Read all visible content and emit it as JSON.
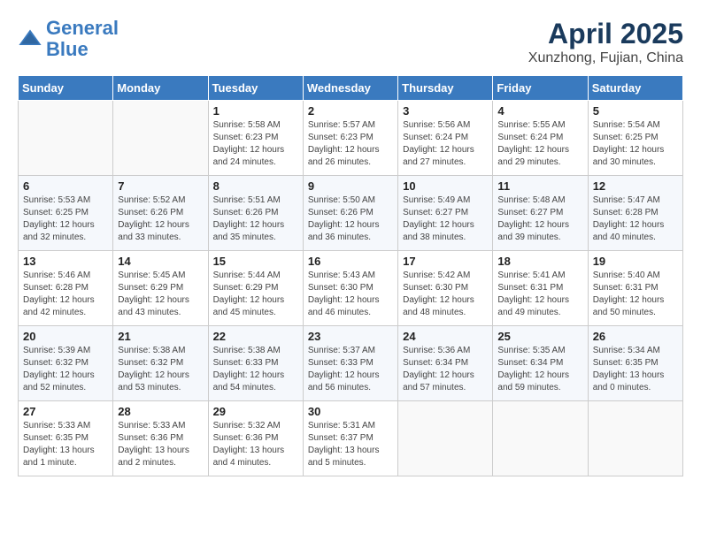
{
  "header": {
    "logo_line1": "General",
    "logo_line2": "Blue",
    "month": "April 2025",
    "location": "Xunzhong, Fujian, China"
  },
  "weekdays": [
    "Sunday",
    "Monday",
    "Tuesday",
    "Wednesday",
    "Thursday",
    "Friday",
    "Saturday"
  ],
  "weeks": [
    [
      {
        "day": "",
        "info": ""
      },
      {
        "day": "",
        "info": ""
      },
      {
        "day": "1",
        "info": "Sunrise: 5:58 AM\nSunset: 6:23 PM\nDaylight: 12 hours\nand 24 minutes."
      },
      {
        "day": "2",
        "info": "Sunrise: 5:57 AM\nSunset: 6:23 PM\nDaylight: 12 hours\nand 26 minutes."
      },
      {
        "day": "3",
        "info": "Sunrise: 5:56 AM\nSunset: 6:24 PM\nDaylight: 12 hours\nand 27 minutes."
      },
      {
        "day": "4",
        "info": "Sunrise: 5:55 AM\nSunset: 6:24 PM\nDaylight: 12 hours\nand 29 minutes."
      },
      {
        "day": "5",
        "info": "Sunrise: 5:54 AM\nSunset: 6:25 PM\nDaylight: 12 hours\nand 30 minutes."
      }
    ],
    [
      {
        "day": "6",
        "info": "Sunrise: 5:53 AM\nSunset: 6:25 PM\nDaylight: 12 hours\nand 32 minutes."
      },
      {
        "day": "7",
        "info": "Sunrise: 5:52 AM\nSunset: 6:26 PM\nDaylight: 12 hours\nand 33 minutes."
      },
      {
        "day": "8",
        "info": "Sunrise: 5:51 AM\nSunset: 6:26 PM\nDaylight: 12 hours\nand 35 minutes."
      },
      {
        "day": "9",
        "info": "Sunrise: 5:50 AM\nSunset: 6:26 PM\nDaylight: 12 hours\nand 36 minutes."
      },
      {
        "day": "10",
        "info": "Sunrise: 5:49 AM\nSunset: 6:27 PM\nDaylight: 12 hours\nand 38 minutes."
      },
      {
        "day": "11",
        "info": "Sunrise: 5:48 AM\nSunset: 6:27 PM\nDaylight: 12 hours\nand 39 minutes."
      },
      {
        "day": "12",
        "info": "Sunrise: 5:47 AM\nSunset: 6:28 PM\nDaylight: 12 hours\nand 40 minutes."
      }
    ],
    [
      {
        "day": "13",
        "info": "Sunrise: 5:46 AM\nSunset: 6:28 PM\nDaylight: 12 hours\nand 42 minutes."
      },
      {
        "day": "14",
        "info": "Sunrise: 5:45 AM\nSunset: 6:29 PM\nDaylight: 12 hours\nand 43 minutes."
      },
      {
        "day": "15",
        "info": "Sunrise: 5:44 AM\nSunset: 6:29 PM\nDaylight: 12 hours\nand 45 minutes."
      },
      {
        "day": "16",
        "info": "Sunrise: 5:43 AM\nSunset: 6:30 PM\nDaylight: 12 hours\nand 46 minutes."
      },
      {
        "day": "17",
        "info": "Sunrise: 5:42 AM\nSunset: 6:30 PM\nDaylight: 12 hours\nand 48 minutes."
      },
      {
        "day": "18",
        "info": "Sunrise: 5:41 AM\nSunset: 6:31 PM\nDaylight: 12 hours\nand 49 minutes."
      },
      {
        "day": "19",
        "info": "Sunrise: 5:40 AM\nSunset: 6:31 PM\nDaylight: 12 hours\nand 50 minutes."
      }
    ],
    [
      {
        "day": "20",
        "info": "Sunrise: 5:39 AM\nSunset: 6:32 PM\nDaylight: 12 hours\nand 52 minutes."
      },
      {
        "day": "21",
        "info": "Sunrise: 5:38 AM\nSunset: 6:32 PM\nDaylight: 12 hours\nand 53 minutes."
      },
      {
        "day": "22",
        "info": "Sunrise: 5:38 AM\nSunset: 6:33 PM\nDaylight: 12 hours\nand 54 minutes."
      },
      {
        "day": "23",
        "info": "Sunrise: 5:37 AM\nSunset: 6:33 PM\nDaylight: 12 hours\nand 56 minutes."
      },
      {
        "day": "24",
        "info": "Sunrise: 5:36 AM\nSunset: 6:34 PM\nDaylight: 12 hours\nand 57 minutes."
      },
      {
        "day": "25",
        "info": "Sunrise: 5:35 AM\nSunset: 6:34 PM\nDaylight: 12 hours\nand 59 minutes."
      },
      {
        "day": "26",
        "info": "Sunrise: 5:34 AM\nSunset: 6:35 PM\nDaylight: 13 hours\nand 0 minutes."
      }
    ],
    [
      {
        "day": "27",
        "info": "Sunrise: 5:33 AM\nSunset: 6:35 PM\nDaylight: 13 hours\nand 1 minute."
      },
      {
        "day": "28",
        "info": "Sunrise: 5:33 AM\nSunset: 6:36 PM\nDaylight: 13 hours\nand 2 minutes."
      },
      {
        "day": "29",
        "info": "Sunrise: 5:32 AM\nSunset: 6:36 PM\nDaylight: 13 hours\nand 4 minutes."
      },
      {
        "day": "30",
        "info": "Sunrise: 5:31 AM\nSunset: 6:37 PM\nDaylight: 13 hours\nand 5 minutes."
      },
      {
        "day": "",
        "info": ""
      },
      {
        "day": "",
        "info": ""
      },
      {
        "day": "",
        "info": ""
      }
    ]
  ]
}
